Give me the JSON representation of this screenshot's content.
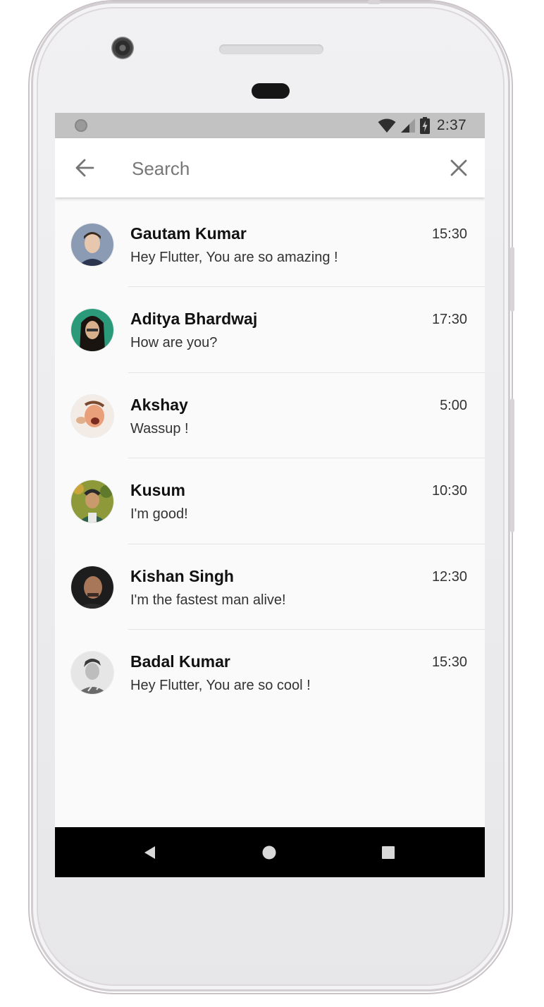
{
  "status_bar": {
    "time": "2:37",
    "icons": [
      "notification-dot-icon",
      "wifi-icon",
      "signal-icon",
      "battery-charging-icon"
    ]
  },
  "search": {
    "placeholder": "Search",
    "value": "",
    "back_icon": "arrow-back-icon",
    "clear_icon": "close-icon"
  },
  "chats": [
    {
      "name": "Gautam Kumar",
      "message": "Hey Flutter, You are so amazing !",
      "time": "15:30",
      "avatar_colors": [
        "#8a9bb3",
        "#e7c7ae",
        "#3a2a20"
      ]
    },
    {
      "name": "Aditya Bhardwaj",
      "message": "How are you?",
      "time": "17:30",
      "avatar_colors": [
        "#2a9a7a",
        "#d9b08c",
        "#1a1410"
      ]
    },
    {
      "name": "Akshay",
      "message": "Wassup !",
      "time": "5:00",
      "avatar_colors": [
        "#f3ece6",
        "#e9a07a",
        "#7a4a30"
      ]
    },
    {
      "name": "Kusum",
      "message": "I'm good!",
      "time": "10:30",
      "avatar_colors": [
        "#8e9a3a",
        "#c99a6b",
        "#2a2a2a"
      ]
    },
    {
      "name": "Kishan Singh",
      "message": "I'm the fastest man alive!",
      "time": "12:30",
      "avatar_colors": [
        "#1d1d1d",
        "#a8775a",
        "#3a2c25"
      ]
    },
    {
      "name": "Badal Kumar",
      "message": "Hey Flutter, You are so cool !",
      "time": "15:30",
      "avatar_colors": [
        "#e6e6e6",
        "#bdbdbd",
        "#3a3a3a"
      ]
    }
  ],
  "nav_bar": {
    "buttons": [
      "back-triangle-icon",
      "home-circle-icon",
      "recents-square-icon"
    ]
  }
}
